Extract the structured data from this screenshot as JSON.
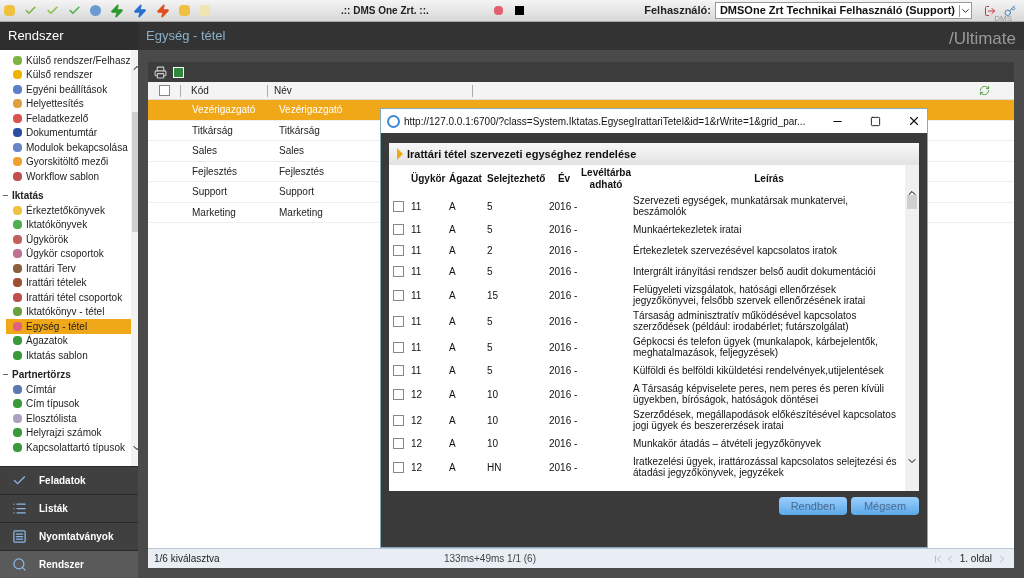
{
  "top_bar": {
    "title": ".:: DMS One Zrt. ::.",
    "user_label": "Felhasználó:",
    "user_value": "DMSOne Zrt Technikai Felhasználó (Support)"
  },
  "sidebar": {
    "title": "Rendszer",
    "groups": [
      {
        "items": [
          {
            "label": "Külső rendszer/Felhasz",
            "selected": false
          },
          {
            "label": "Külső rendszer",
            "selected": false
          },
          {
            "label": "Egyéni beállítások",
            "selected": false
          },
          {
            "label": "Helyettesítés",
            "selected": false
          },
          {
            "label": "Feladatkezelő",
            "selected": false
          },
          {
            "label": "Dokumentumtár",
            "selected": false
          },
          {
            "label": "Modulok bekapcsolása",
            "selected": false
          },
          {
            "label": "Gyorskitöltő mezői",
            "selected": false
          },
          {
            "label": "Workflow sablon",
            "selected": false
          }
        ]
      },
      {
        "title": "Iktatás",
        "expanded": true,
        "items": [
          {
            "label": "Érkeztetőkönyvek",
            "selected": false
          },
          {
            "label": "Iktatókönyvek",
            "selected": false
          },
          {
            "label": "Ügykörök",
            "selected": false
          },
          {
            "label": "Ügykör csoportok",
            "selected": false
          },
          {
            "label": "Irattári Terv",
            "selected": false
          },
          {
            "label": "Irattári tételek",
            "selected": false
          },
          {
            "label": "Irattári tétel csoportok",
            "selected": false
          },
          {
            "label": "Iktatókönyv - tétel",
            "selected": false
          },
          {
            "label": "Egység - tétel",
            "selected": true
          },
          {
            "label": "Ágazatok",
            "selected": false
          },
          {
            "label": "Iktatás sablon",
            "selected": false
          }
        ]
      },
      {
        "title": "Partnertörzs",
        "expanded": true,
        "items": [
          {
            "label": "Címtár",
            "selected": false
          },
          {
            "label": "Cím típusok",
            "selected": false
          },
          {
            "label": "Elosztólista",
            "selected": false
          },
          {
            "label": "Helyrajzi számok",
            "selected": false
          },
          {
            "label": "Kapcsolattartó típusok",
            "selected": false
          }
        ]
      }
    ]
  },
  "nav": [
    {
      "label": "Feladatok",
      "kind": "check",
      "selected": false
    },
    {
      "label": "Listák",
      "kind": "list",
      "selected": false
    },
    {
      "label": "Nyomtatványok",
      "kind": "form",
      "selected": false
    },
    {
      "label": "Rendszer",
      "kind": "system",
      "selected": true
    }
  ],
  "main": {
    "title": "Egység - tétel",
    "logo": "/Ultimate",
    "logo_small": "DMS",
    "grid": {
      "columns": [
        "Kód",
        "Név"
      ],
      "all_checked": false,
      "rows": [
        {
          "kod": "Vezérigazgató",
          "nev": "Vezérigazgató",
          "selected": true
        },
        {
          "kod": "Titkárság",
          "nev": "Titkárság",
          "selected": false
        },
        {
          "kod": "Sales",
          "nev": "Sales",
          "selected": false
        },
        {
          "kod": "Fejlesztés",
          "nev": "Fejlesztés",
          "selected": false
        },
        {
          "kod": "Support",
          "nev": "Support",
          "selected": false
        },
        {
          "kod": "Marketing",
          "nev": "Marketing",
          "selected": false
        }
      ]
    },
    "status": {
      "selection": "1/6 kiválasztva",
      "timing": "133ms+49ms 1/1 (6)",
      "page": "1. oldal"
    }
  },
  "modal": {
    "url": "http://127.0.0.1:6700/?class=System.Iktatas.EgysegIrattariTetel&id=1&rWrite=1&grid_par...",
    "section": "Irattári tétel szervezeti egységhez rendelése",
    "columns": [
      "Ügykör",
      "Ágazat",
      "Selejtezhető",
      "Év",
      "Levéltárba adható",
      "Leírás"
    ],
    "rows": [
      {
        "checked": false,
        "ugykor": "11",
        "agazat": "A",
        "selejt": "5",
        "ev": "2016 -",
        "leiras": "Szervezeti egységek, munkatársak munkatervei, beszámolók"
      },
      {
        "checked": false,
        "ugykor": "11",
        "agazat": "A",
        "selejt": "5",
        "ev": "2016 -",
        "leiras": "Munkaértekezletek iratai"
      },
      {
        "checked": false,
        "ugykor": "11",
        "agazat": "A",
        "selejt": "2",
        "ev": "2016 -",
        "leiras": "Értekezletek szervezésével kapcsolatos iratok"
      },
      {
        "checked": false,
        "ugykor": "11",
        "agazat": "A",
        "selejt": "5",
        "ev": "2016 -",
        "leiras": "Intergrált irányítási rendszer belső audit dokumentációi"
      },
      {
        "checked": false,
        "ugykor": "11",
        "agazat": "A",
        "selejt": "15",
        "ev": "2016 -",
        "leiras": "Felügyeleti vizsgálatok, hatósági ellenőrzések jegyzőkönyvei, felsőbb szervek ellenőrzésének iratai"
      },
      {
        "checked": false,
        "ugykor": "11",
        "agazat": "A",
        "selejt": "5",
        "ev": "2016 -",
        "leiras": "Társaság adminisztratív működésével kapcsolatos szerződések (például: irodabérlet; futárszolgálat)"
      },
      {
        "checked": false,
        "ugykor": "11",
        "agazat": "A",
        "selejt": "5",
        "ev": "2016 -",
        "leiras": "Gépkocsi és telefon ügyek (munkalapok, kárbejelentők, meghatalmazások, feljegyzések)"
      },
      {
        "checked": false,
        "ugykor": "11",
        "agazat": "A",
        "selejt": "5",
        "ev": "2016 -",
        "leiras": "Külföldi és belföldi kiküldetési rendelvények,utijelentések"
      },
      {
        "checked": false,
        "ugykor": "12",
        "agazat": "A",
        "selejt": "10",
        "ev": "2016 -",
        "leiras": "A Társaság képviselete peres, nem peres és peren kívüli ügyekben, bíróságok, hatóságok döntései"
      },
      {
        "checked": false,
        "ugykor": "12",
        "agazat": "A",
        "selejt": "10",
        "ev": "2016 -",
        "leiras": "Szerződések, megállapodások előkészítésével kapcsolatos jogi ügyek és beszererzések iratai"
      },
      {
        "checked": false,
        "ugykor": "12",
        "agazat": "A",
        "selejt": "10",
        "ev": "2016 -",
        "leiras": "Munkakör átadás – átvételi jegyzőkönyvek"
      },
      {
        "checked": false,
        "ugykor": "12",
        "agazat": "A",
        "selejt": "HN",
        "ev": "2016 -",
        "leiras": "Iratkezelési ügyek, irattározással kapcsolatos selejtezési és átadási jegyzőkönyvek, jegyzékek"
      }
    ],
    "buttons": [
      "Rendben",
      "Mégsem"
    ]
  }
}
